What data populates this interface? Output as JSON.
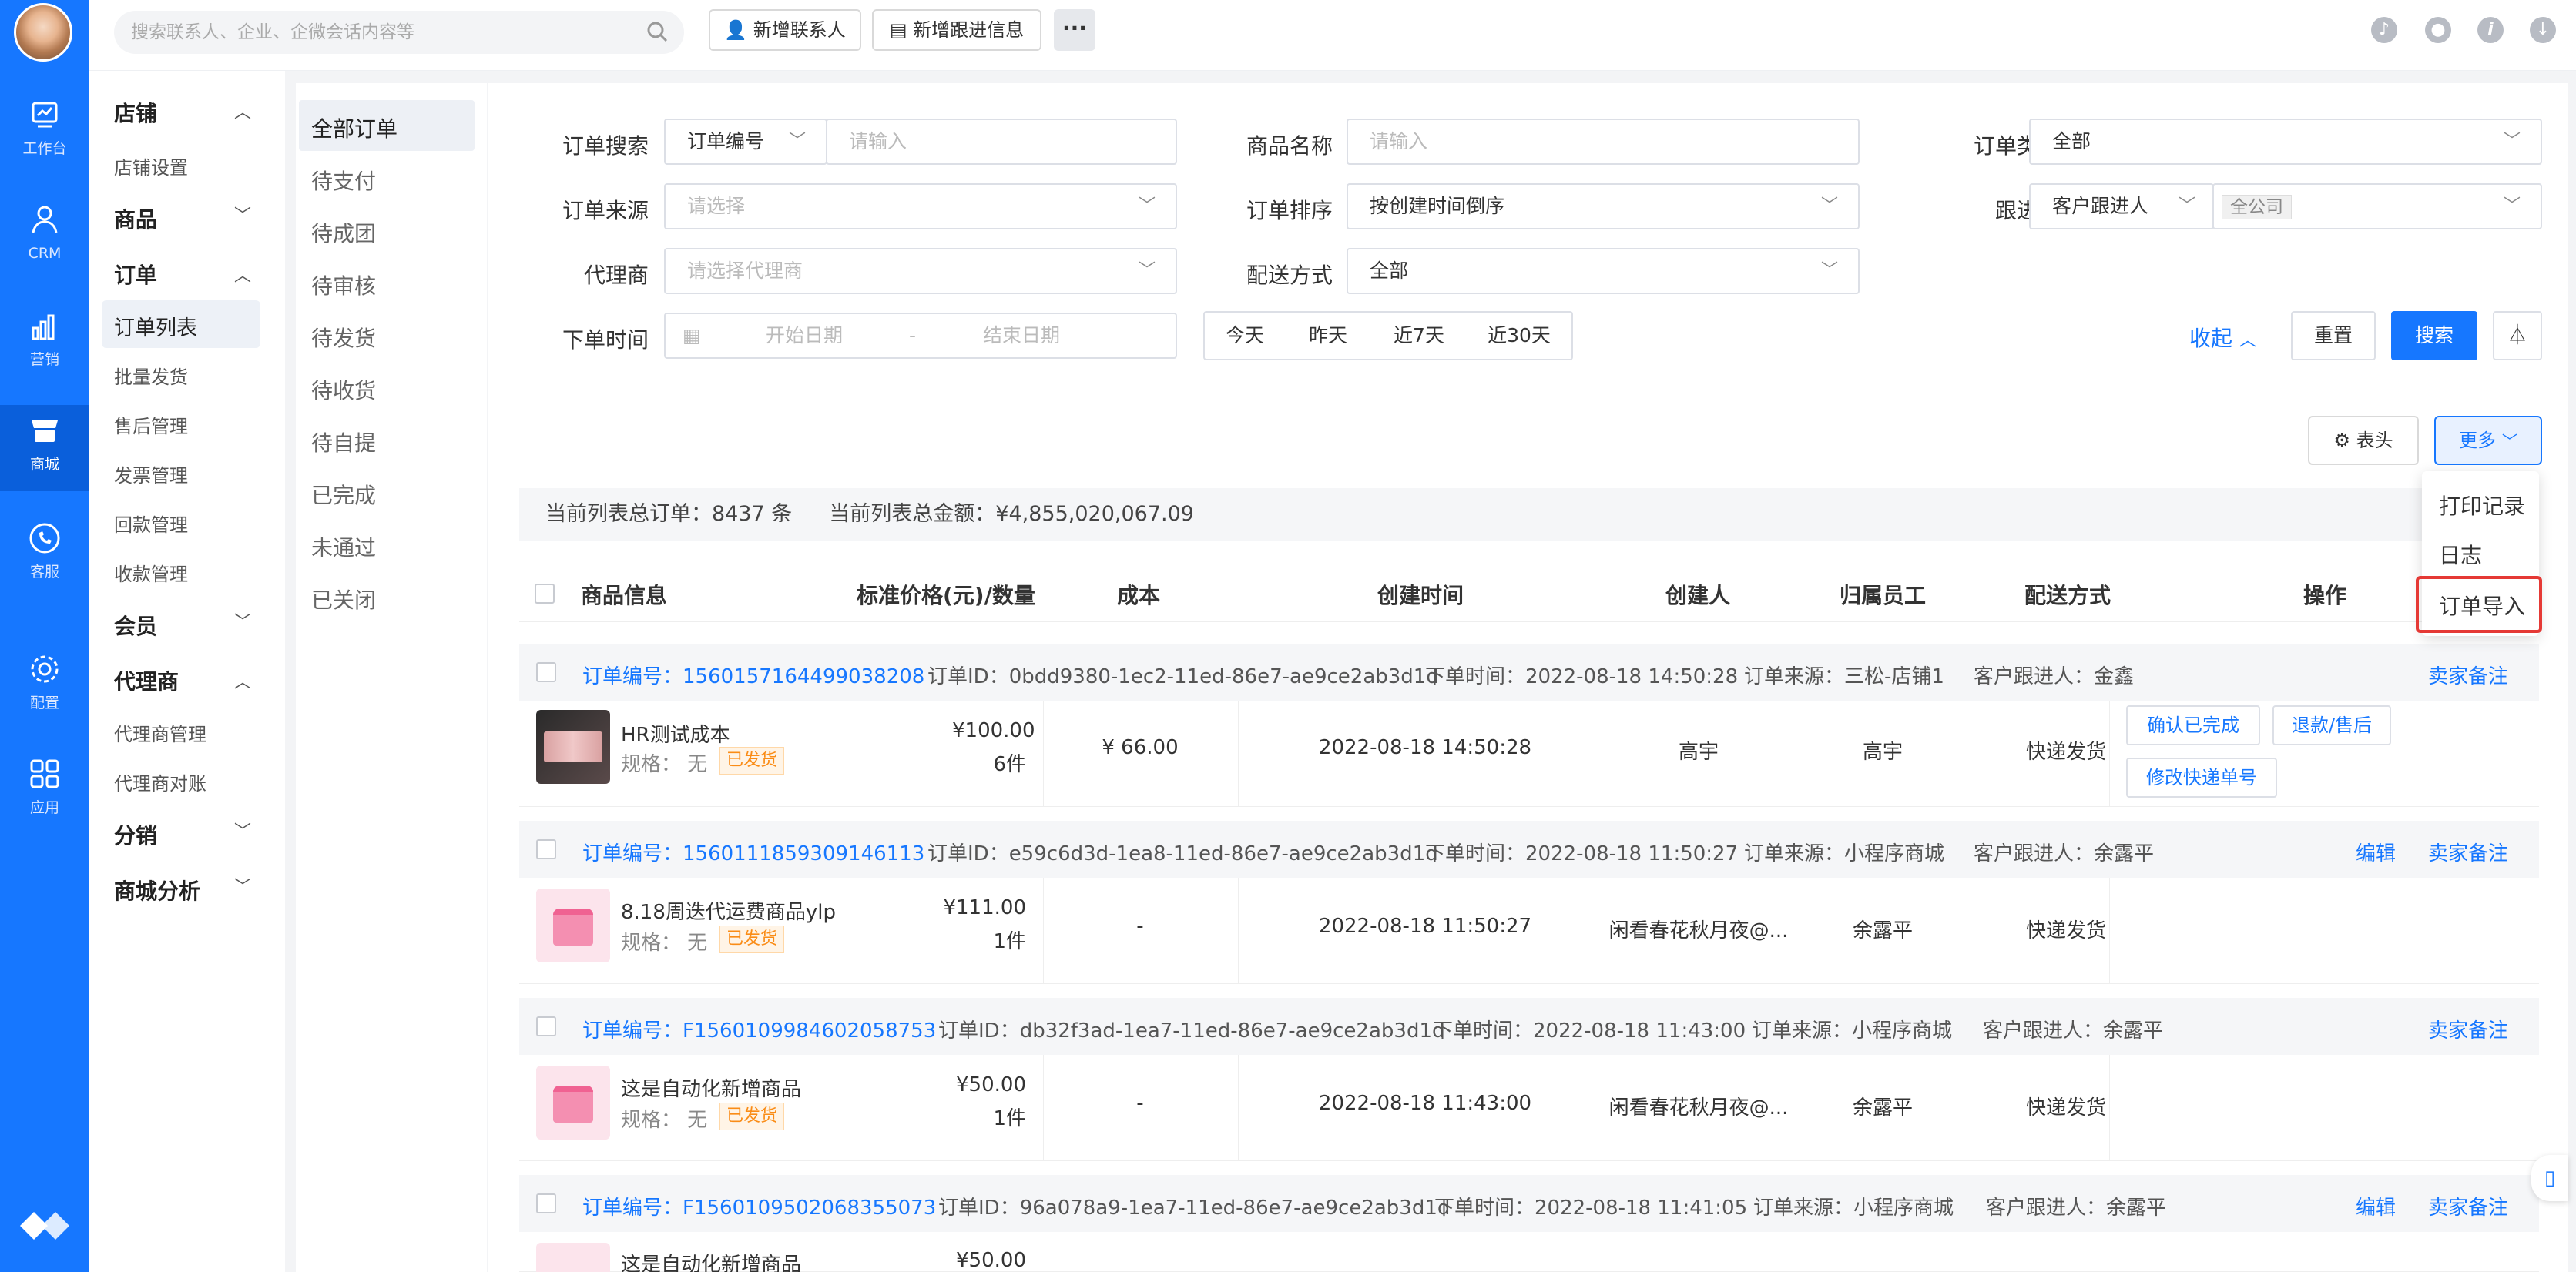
{
  "topbar": {
    "search_placeholder": "搜索联系人、企业、企微会话内容等",
    "new_contact": "新增联系人",
    "new_followup": "新增跟进信息",
    "more": "···"
  },
  "rail": [
    {
      "label": "工作台",
      "icon": "dashboard-icon"
    },
    {
      "label": "CRM",
      "icon": "person-icon"
    },
    {
      "label": "营销",
      "icon": "bar-chart-icon"
    },
    {
      "label": "商城",
      "icon": "shop-icon"
    },
    {
      "label": "客服",
      "icon": "phone-icon"
    },
    {
      "label": "配置",
      "icon": "gear-icon"
    },
    {
      "label": "应用",
      "icon": "apps-grid-icon"
    }
  ],
  "nav": {
    "store": "店铺",
    "store_settings": "店铺设置",
    "goods": "商品",
    "order": "订单",
    "order_list": "订单列表",
    "batch_ship": "批量发货",
    "after_sale": "售后管理",
    "invoice": "发票管理",
    "payment_back": "回款管理",
    "collection": "收款管理",
    "member": "会员",
    "agent": "代理商",
    "agent_mgmt": "代理商管理",
    "agent_recon": "代理商对账",
    "distribution": "分销",
    "analysis": "商城分析"
  },
  "status_tabs": [
    "全部订单",
    "待支付",
    "待成团",
    "待审核",
    "待发货",
    "待收货",
    "待自提",
    "已完成",
    "未通过",
    "已关闭"
  ],
  "filters": {
    "order_search": "订单搜索",
    "order_search_type": "订单编号",
    "input_placeholder": "请输入",
    "goods_name": "商品名称",
    "goods_placeholder": "请输入",
    "order_type": "订单类型",
    "order_type_val": "全部",
    "order_source": "订单来源",
    "select_placeholder": "请选择",
    "order_sort": "订单排序",
    "order_sort_val": "按创建时间倒序",
    "follower": "跟进人",
    "follower_type": "客户跟进人",
    "follower_scope": "全公司",
    "agent": "代理商",
    "agent_placeholder": "请选择代理商",
    "delivery": "配送方式",
    "delivery_val": "全部",
    "order_time": "下单时间",
    "start_date": "开始日期",
    "sep": "-",
    "end_date": "结束日期",
    "quick": [
      "今天",
      "昨天",
      "近7天",
      "近30天"
    ],
    "collapse": "收起",
    "reset": "重置",
    "search": "搜索"
  },
  "toolbar": {
    "columns": "表头",
    "more": "更多"
  },
  "more_menu": [
    "打印记录",
    "日志",
    "订单导入"
  ],
  "summary": {
    "total_orders": "当前列表总订单：8437 条",
    "total_amount": "当前列表总金额：¥4,855,020,067.09"
  },
  "columns": [
    "商品信息",
    "标准价格(元)/数量",
    "成本",
    "创建时间",
    "创建人",
    "归属员工",
    "配送方式",
    "操作"
  ],
  "orders": [
    {
      "no_label": "订单编号：",
      "no": "1560157164499038208",
      "id": "订单ID：0bdd9380-1ec2-11ed-86e7-ae9ce2ab3d1d",
      "time": "下单时间：2022-08-18 14:50:28",
      "source": "订单来源：三松-店铺1",
      "follower": "客户跟进人：金鑫",
      "edit": "",
      "remark": "卖家备注",
      "goods": "HR测试成本",
      "spec": "规格：  无",
      "tag": "已发货",
      "price": "¥100.00",
      "qty": "6件",
      "cost": "¥ 66.00",
      "created": "2022-08-18 14:50:28",
      "creator": "高宇",
      "owner": "高宇",
      "delivery": "快递发货",
      "actions": [
        "确认已完成",
        "退款/售后",
        "修改快递单号"
      ]
    },
    {
      "no_label": "订单编号：",
      "no": "1560111859309146113",
      "id": "订单ID：e59c6d3d-1ea8-11ed-86e7-ae9ce2ab3d1d",
      "time": "下单时间：2022-08-18 11:50:27",
      "source": "订单来源：小程序商城",
      "follower": "客户跟进人：余露平",
      "edit": "编辑",
      "remark": "卖家备注",
      "goods": "8.18周迭代运费商品ylp",
      "spec": "规格：  无",
      "tag": "已发货",
      "price": "¥111.00",
      "qty": "1件",
      "cost": "-",
      "created": "2022-08-18 11:50:27",
      "creator": "闲看春花秋月夜@...",
      "owner": "余露平",
      "delivery": "快递发货",
      "actions": []
    },
    {
      "no_label": "订单编号：",
      "no": "F1560109984602058753",
      "id": "订单ID：db32f3ad-1ea7-11ed-86e7-ae9ce2ab3d1d",
      "time": "下单时间：2022-08-18 11:43:00",
      "source": "订单来源：小程序商城",
      "follower": "客户跟进人：余露平",
      "edit": "",
      "remark": "卖家备注",
      "goods": "这是自动化新增商品",
      "spec": "规格：  无",
      "tag": "已发货",
      "price": "¥50.00",
      "qty": "1件",
      "cost": "-",
      "created": "2022-08-18 11:43:00",
      "creator": "闲看春花秋月夜@...",
      "owner": "余露平",
      "delivery": "快递发货",
      "actions": []
    },
    {
      "no_label": "订单编号：",
      "no": "F1560109502068355073",
      "id": "订单ID：96a078a9-1ea7-11ed-86e7-ae9ce2ab3d1d",
      "time": "下单时间：2022-08-18 11:41:05",
      "source": "订单来源：小程序商城",
      "follower": "客户跟进人：余露平",
      "edit": "编辑",
      "remark": "卖家备注",
      "goods": "这是自动化新增商品",
      "spec": "",
      "tag": "",
      "price": "¥50.00",
      "qty": "",
      "cost": "",
      "created": "",
      "creator": "",
      "owner": "",
      "delivery": "",
      "actions": []
    }
  ]
}
